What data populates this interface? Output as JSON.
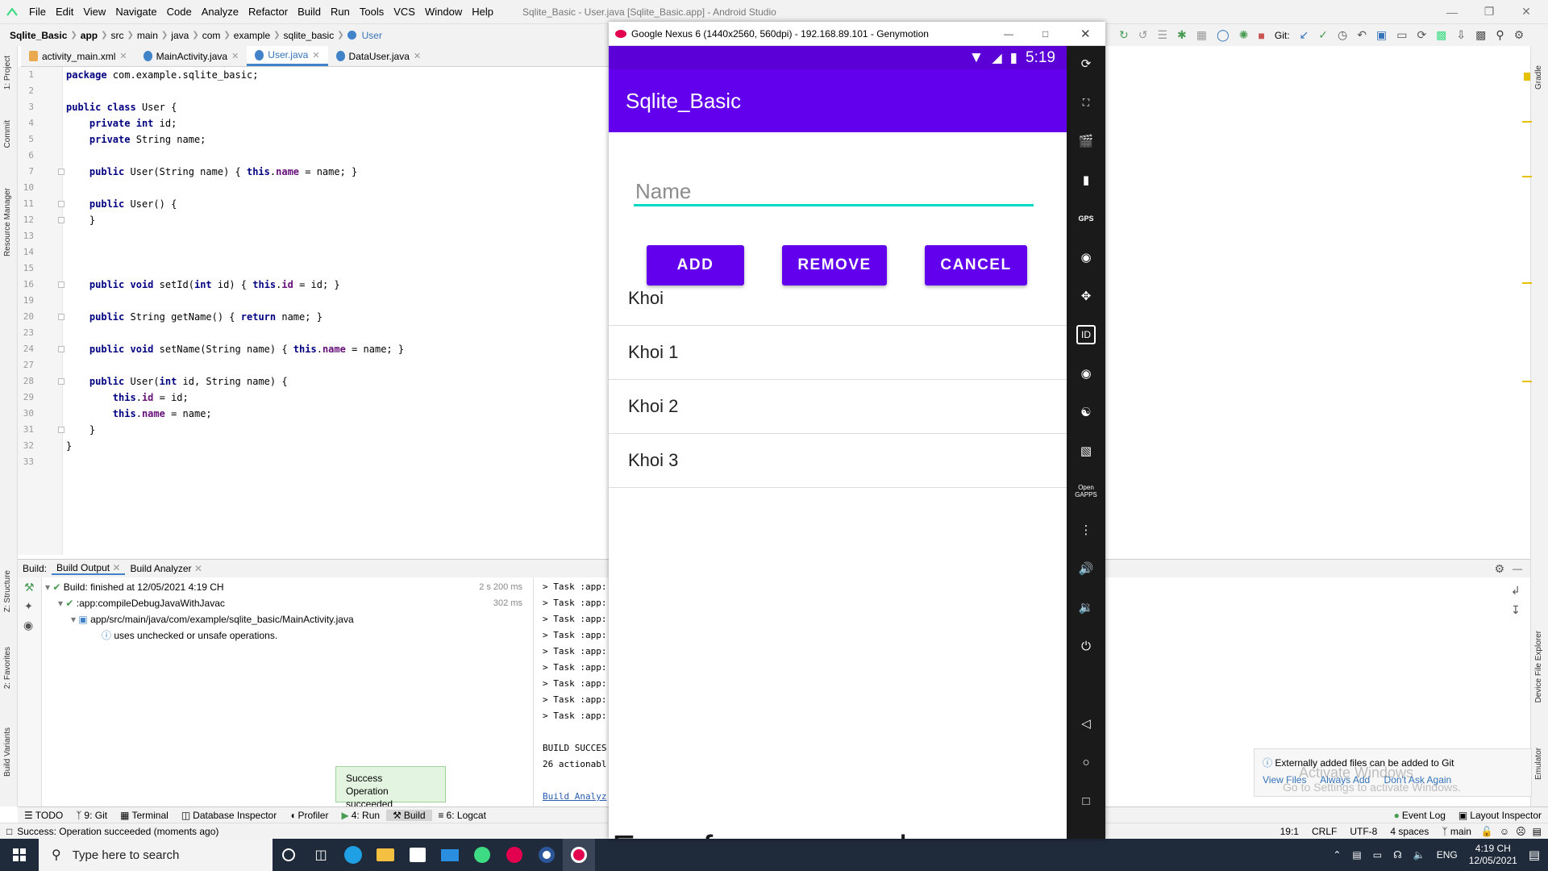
{
  "menubar": {
    "items": [
      "File",
      "Edit",
      "View",
      "Navigate",
      "Code",
      "Analyze",
      "Refactor",
      "Build",
      "Run",
      "Tools",
      "VCS",
      "Window",
      "Help"
    ],
    "title": "Sqlite_Basic - User.java [Sqlite_Basic.app] - Android Studio"
  },
  "breadcrumb": [
    "Sqlite_Basic",
    "app",
    "src",
    "main",
    "java",
    "com",
    "example",
    "sqlite_basic",
    "User"
  ],
  "toolbar": {
    "git_label": "Git:"
  },
  "tabs": [
    {
      "label": "activity_main.xml"
    },
    {
      "label": "MainActivity.java"
    },
    {
      "label": "User.java"
    },
    {
      "label": "DataUser.java"
    }
  ],
  "sidebar_left": [
    "1: Project",
    "Commit",
    "Resource Manager",
    "Z: Structure",
    "2: Favorites",
    "Build Variants"
  ],
  "sidebar_right": [
    "Gradle",
    "Device File Explorer",
    "Emulator"
  ],
  "editor": {
    "line_numbers": [
      "1",
      "2",
      "3",
      "4",
      "5",
      "6",
      "7",
      "10",
      "11",
      "12",
      "13",
      "14",
      "15",
      "16",
      "19",
      "20",
      "23",
      "24",
      "27",
      "28",
      "29",
      "30",
      "31",
      "32",
      "33"
    ],
    "lines": [
      "package com.example.sqlite_basic;",
      "",
      "public class User {",
      "    private int id;",
      "    private String name;",
      "",
      "    public User(String name) { this.name = name; }",
      "",
      "    public User() {",
      "    }",
      "",
      "",
      "",
      "    public void setId(int id) { this.id = id; }",
      "",
      "    public String getName() { return name; }",
      "",
      "    public void setName(String name) { this.name = name; }",
      "",
      "    public User(int id, String name) {",
      "        this.id = id;",
      "        this.name = name;",
      "    }",
      "}",
      ""
    ]
  },
  "build": {
    "header_label": "Build:",
    "tabs": [
      "Build Output",
      "Build Analyzer"
    ],
    "tree": [
      {
        "text": "Build: finished at 12/05/2021 4:19 CH",
        "time": "2 s 200 ms"
      },
      {
        "text": ":app:compileDebugJavaWithJavac",
        "time": "302 ms"
      },
      {
        "text": "app/src/main/java/com/example/sqlite_basic/MainActivity.java",
        "time": ""
      },
      {
        "text": "uses unchecked or unsafe operations.",
        "time": ""
      }
    ],
    "console": [
      "> Task :app:",
      "> Task :app:",
      "> Task :app:",
      "> Task :app:",
      "> Task :app:",
      "> Task :app:",
      "> Task :app:",
      "> Task :app:",
      "> Task :app:",
      "",
      "BUILD SUCCES",
      "26 actionabl",
      "",
      "Build Analyz"
    ]
  },
  "toast": {
    "title": "Success",
    "message": "Operation succeeded"
  },
  "tool_windows": [
    "TODO",
    "9: Git",
    "Terminal",
    "Database Inspector",
    "Profiler",
    "4: Run",
    "Build",
    "6: Logcat"
  ],
  "tool_windows_right": [
    "Event Log",
    "Layout Inspector"
  ],
  "status": {
    "message": "Success: Operation succeeded (moments ago)",
    "position": "19:1",
    "line_sep": "CRLF",
    "encoding": "UTF-8",
    "indent": "4 spaces",
    "branch": "main"
  },
  "emulator": {
    "title": "Google Nexus 6 (1440x2560, 560dpi) - 192.168.89.101 - Genymotion",
    "time": "5:19",
    "app_title": "Sqlite_Basic",
    "name_placeholder": "Name",
    "buttons": [
      "ADD",
      "REMOVE",
      "CANCEL"
    ],
    "items": [
      "Khoi",
      "Khoi 1",
      "Khoi 2",
      "Khoi 3"
    ],
    "watermark": "Free for personal use",
    "side_icons": [
      "rotate-icon",
      "pixel-perfect-icon",
      "capture-icon",
      "battery-icon",
      "gps-icon",
      "camera-icon",
      "move-icon",
      "identifiers-icon",
      "media-icon",
      "cast-icon",
      "sms-icon",
      "open-gapps-icon",
      "share-icon",
      "volume-up-icon",
      "volume-down-icon",
      "power-icon",
      "back-icon",
      "home-icon",
      "recent-apps-icon"
    ],
    "gps_label": "GPS",
    "id_label": "ID",
    "gapps_label": "Open GAPPS"
  },
  "notification": {
    "text": "Externally added files can be added to Git",
    "actions": [
      "View Files",
      "Always Add",
      "Don't Ask Again"
    ],
    "watermark1": "Activate Windows",
    "watermark2": "Go to Settings to activate Windows."
  },
  "taskbar": {
    "search_placeholder": "Type here to search",
    "lang": "ENG",
    "time": "4:19 CH",
    "date": "12/05/2021"
  },
  "colors": {
    "primary": "#6200ee",
    "primary_dark": "#3700b3",
    "accent": "#03dac5",
    "ide_accent": "#4083c9"
  }
}
